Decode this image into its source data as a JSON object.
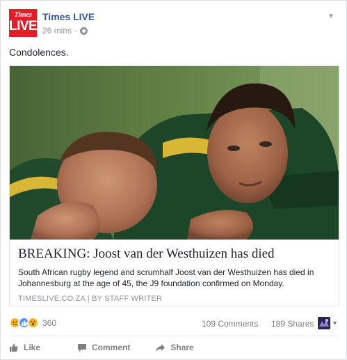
{
  "post": {
    "page_name": "Times LIVE",
    "time": "26 mins",
    "time_separator": "·",
    "status_text": "Condolences.",
    "logo": {
      "line1": "Times",
      "line2": "LIVE",
      "brand_color": "#e41e26"
    }
  },
  "link_preview": {
    "title": "BREAKING: Joost van der Westhuizen has died",
    "description": "South African rugby legend and scrumhalf Joost van der Westhuizen has died in Johannesburg at the age of 45, the J9 foundation confirmed on Monday.",
    "source": "TIMESLIVE.CO.ZA",
    "source_separator": "|",
    "author": "BY STAFF WRITER"
  },
  "stats": {
    "reaction_count": "360",
    "reactions": [
      "sad",
      "like",
      "wow"
    ],
    "comments": "109 Comments",
    "shares": "189 Shares"
  },
  "actions": {
    "like": "Like",
    "comment": "Comment",
    "share": "Share"
  },
  "icons": {
    "menu": "chevron-down-icon",
    "privacy": "globe-icon",
    "like": "thumbs-up-icon",
    "comment": "speech-bubble-icon",
    "share": "share-arrow-icon"
  },
  "colors": {
    "link_blue": "#365899",
    "meta_grey": "#90949c",
    "like_blue": "#5890ff",
    "reaction_yellow": "#f7b125",
    "action_grey": "#7f7f7f"
  }
}
